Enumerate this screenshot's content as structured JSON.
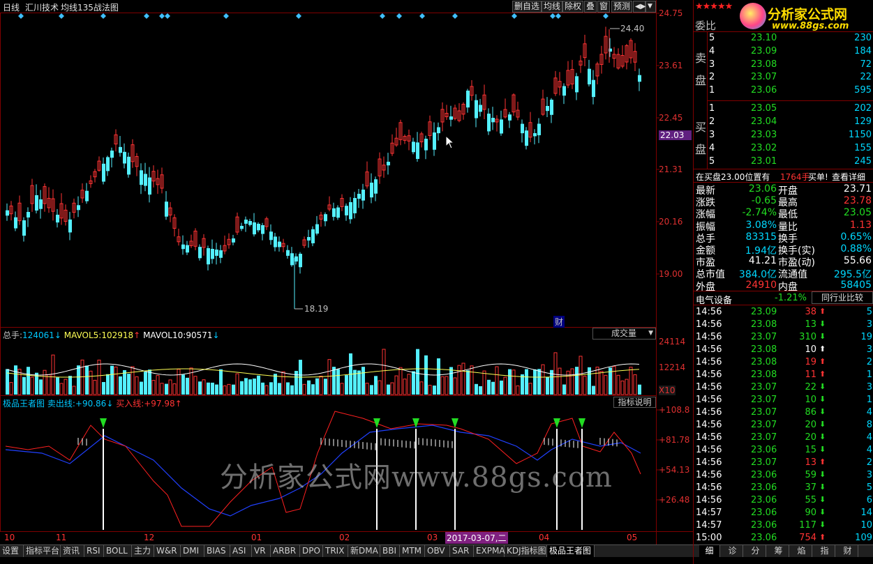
{
  "topbar": {
    "period": "日线",
    "stock_name": "汇川技术",
    "chart_name": "均线135战法图",
    "buttons": [
      "删自选",
      "均线",
      "除权",
      "叠",
      "窗",
      "预测"
    ],
    "more_icon": "◀▶",
    "menu_icon": "▼"
  },
  "price_axis": [
    "24.75",
    "23.61",
    "22.45",
    "22.03",
    "21.31",
    "20.16",
    "19.00"
  ],
  "price_high_label": "24.40",
  "price_low_label": "18.19",
  "finance_marker": "财",
  "volume": {
    "total_label": "总手:",
    "total_value": "124061",
    "mavol5_label": "MAVOL5:",
    "mavol5_value": "102918",
    "mavol10_label": "MAVOL10:",
    "mavol10_value": "90571",
    "dropdown": "成交量",
    "axis": [
      "24114",
      "12214",
      "X10"
    ]
  },
  "indicator": {
    "name": "极品王者图",
    "sell_label": "卖出线:",
    "sell_value": "+90.86",
    "buy_label": "买入线:",
    "buy_value": "+97.98",
    "help_button": "指标说明",
    "axis": [
      "+108.8",
      "+81.78",
      "+54.13",
      "+26.48"
    ]
  },
  "watermark": "分析家公式网www.88gs.com",
  "date_axis": [
    "10",
    "11",
    "12",
    "01",
    "02",
    "03",
    "04",
    "05"
  ],
  "date_cursor": "2017-03-07,二",
  "tabs": [
    "设置",
    "指标平台",
    "资讯",
    "RSI",
    "BOLL",
    "主力",
    "W&R",
    "DMI",
    "BIAS",
    "ASI",
    "VR",
    "ARBR",
    "DPO",
    "TRIX",
    "新DMA",
    "BBI",
    "MTM",
    "OBV",
    "SAR",
    "EXPMA",
    "KDJ指标图",
    "极品王者图"
  ],
  "right_tabs": [
    "细",
    "诊",
    "分",
    "筹",
    "焰",
    "指",
    "财"
  ],
  "logo": {
    "stars": "★★★★★",
    "name": "分析家公式网",
    "url": "www.88gs.com"
  },
  "orderbook": {
    "ratio_label": "委比",
    "sell_side": "卖盘",
    "buy_side": "买盘",
    "sell": [
      {
        "level": "5",
        "price": "23.10",
        "vol": "230"
      },
      {
        "level": "4",
        "price": "23.09",
        "vol": "184"
      },
      {
        "level": "3",
        "price": "23.08",
        "vol": "72"
      },
      {
        "level": "2",
        "price": "23.07",
        "vol": "22"
      },
      {
        "level": "1",
        "price": "23.06",
        "vol": "595"
      }
    ],
    "buy": [
      {
        "level": "1",
        "price": "23.05",
        "vol": "202"
      },
      {
        "level": "2",
        "price": "23.04",
        "vol": "129"
      },
      {
        "level": "3",
        "price": "23.03",
        "vol": "1150"
      },
      {
        "level": "4",
        "price": "23.02",
        "vol": "155"
      },
      {
        "level": "5",
        "price": "23.01",
        "vol": "245"
      }
    ],
    "notice_prefix": "在买盘23.00位置有",
    "notice_qty": "1764手",
    "notice_suffix": "买单!",
    "notice_link": "查看详细"
  },
  "stats": [
    {
      "k1": "最新",
      "v1": "23.06",
      "c1": "green",
      "k2": "开盘",
      "v2": "23.71",
      "c2": "white"
    },
    {
      "k1": "涨跌",
      "v1": "-0.65",
      "c1": "green",
      "k2": "最高",
      "v2": "23.78",
      "c2": "red"
    },
    {
      "k1": "涨幅",
      "v1": "-2.74%",
      "c1": "green",
      "k2": "最低",
      "v2": "23.05",
      "c2": "green"
    },
    {
      "k1": "振幅",
      "v1": "3.08%",
      "c1": "cyan",
      "k2": "量比",
      "v2": "1.13",
      "c2": "red"
    },
    {
      "k1": "总手",
      "v1": "83315",
      "c1": "cyan",
      "k2": "换手",
      "v2": "0.65%",
      "c2": "cyan"
    },
    {
      "k1": "金额",
      "v1": "1.94亿",
      "c1": "cyan",
      "k2": "换手(实)",
      "v2": "0.88%",
      "c2": "cyan"
    },
    {
      "k1": "市盈",
      "v1": "41.21",
      "c1": "white",
      "k2": "市盈(动)",
      "v2": "55.66",
      "c2": "white"
    },
    {
      "k1": "总市值",
      "v1": "384.0亿",
      "c1": "cyan",
      "k2": "流通值",
      "v2": "295.5亿",
      "c2": "cyan"
    },
    {
      "k1": "外盘",
      "v1": "24910",
      "c1": "red",
      "k2": "内盘",
      "v2": "58405",
      "c2": "cyan"
    }
  ],
  "sector": {
    "name": "电气设备",
    "change": "-1.21%",
    "compare": "同行业比较"
  },
  "ticks": [
    {
      "t": "14:56",
      "p": "23.09",
      "v": "38",
      "d": "up",
      "n": "5"
    },
    {
      "t": "14:56",
      "p": "23.08",
      "v": "13",
      "d": "down",
      "n": "3"
    },
    {
      "t": "14:56",
      "p": "23.07",
      "v": "310",
      "d": "down",
      "n": "19"
    },
    {
      "t": "14:56",
      "p": "23.08",
      "v": "10",
      "d": "white",
      "n": "3"
    },
    {
      "t": "14:56",
      "p": "23.08",
      "v": "19",
      "d": "up",
      "n": "2"
    },
    {
      "t": "14:56",
      "p": "23.08",
      "v": "11",
      "d": "up",
      "n": "1"
    },
    {
      "t": "14:56",
      "p": "23.07",
      "v": "22",
      "d": "down",
      "n": "3"
    },
    {
      "t": "14:56",
      "p": "23.07",
      "v": "10",
      "d": "down",
      "n": "1"
    },
    {
      "t": "14:56",
      "p": "23.07",
      "v": "86",
      "d": "down",
      "n": "4"
    },
    {
      "t": "14:56",
      "p": "23.07",
      "v": "20",
      "d": "down",
      "n": "8"
    },
    {
      "t": "14:56",
      "p": "23.07",
      "v": "20",
      "d": "down",
      "n": "4"
    },
    {
      "t": "14:56",
      "p": "23.06",
      "v": "15",
      "d": "down",
      "n": "4"
    },
    {
      "t": "14:56",
      "p": "23.07",
      "v": "13",
      "d": "up",
      "n": "2"
    },
    {
      "t": "14:56",
      "p": "23.06",
      "v": "59",
      "d": "down",
      "n": "3"
    },
    {
      "t": "14:56",
      "p": "23.06",
      "v": "37",
      "d": "down",
      "n": "5"
    },
    {
      "t": "14:56",
      "p": "23.06",
      "v": "55",
      "d": "down",
      "n": "6"
    },
    {
      "t": "14:57",
      "p": "23.06",
      "v": "90",
      "d": "down",
      "n": "14"
    },
    {
      "t": "14:57",
      "p": "23.06",
      "v": "117",
      "d": "down",
      "n": "10"
    },
    {
      "t": "15:00",
      "p": "23.06",
      "v": "754",
      "d": "up",
      "n": "109"
    }
  ],
  "colors": {
    "up": "#ff3333",
    "down": "#00e0ff",
    "frame": "#800000",
    "ma": "#2040ff"
  }
}
